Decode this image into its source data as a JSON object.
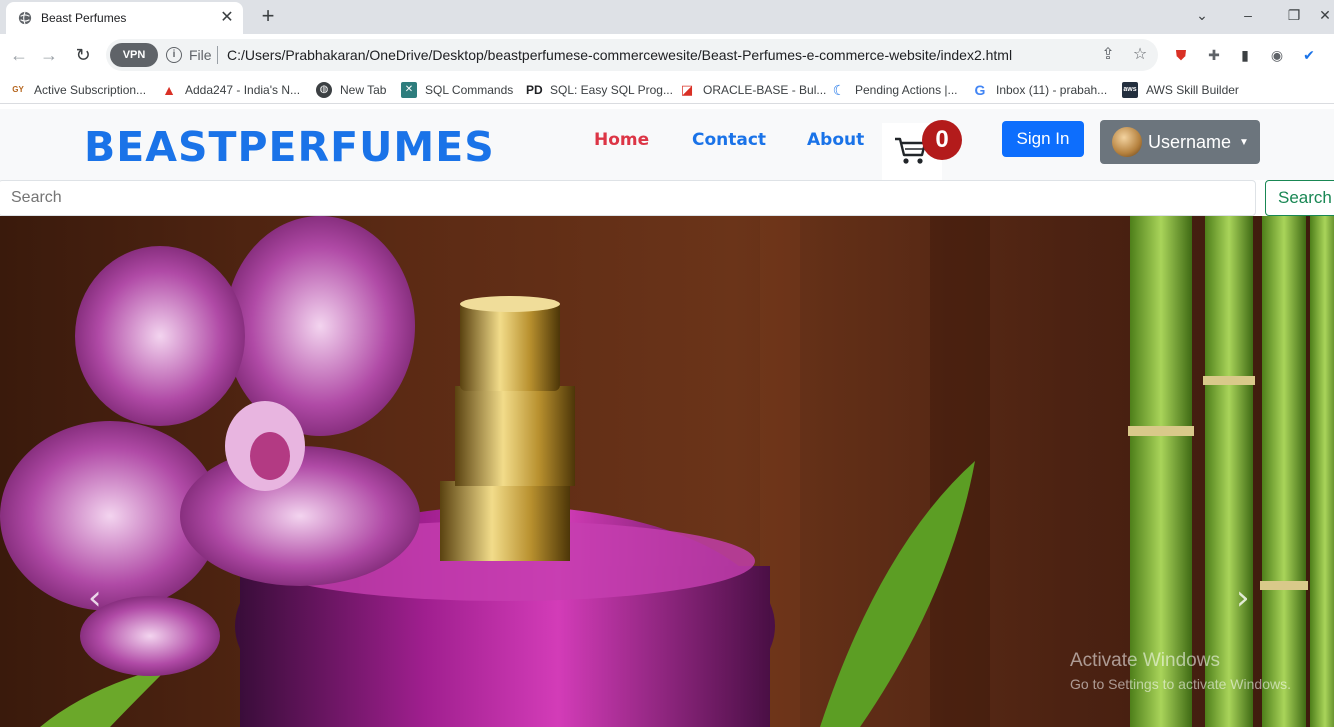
{
  "browser": {
    "tab_title": "Beast Perfumes",
    "tab_close": "✕",
    "new_tab": "+",
    "file_label": "File",
    "url": "C:/Users/Prabhakaran/OneDrive/Desktop/beastperfumese-commercewesite/Beast-Perfumes-e-commerce-website/index2.html",
    "vpn_label": "VPN",
    "bookmarks": [
      {
        "label": "Active Subscription...",
        "icon": "GYTS"
      },
      {
        "label": "Adda247 - India's N...",
        "icon": "A"
      },
      {
        "label": "New Tab",
        "icon": "globe"
      },
      {
        "label": "SQL Commands",
        "icon": "SQL"
      },
      {
        "label": "SQL: Easy SQL Prog...",
        "icon": "PD"
      },
      {
        "label": "ORACLE-BASE - Bul...",
        "icon": "oracle"
      },
      {
        "label": "Pending Actions |...",
        "icon": "K"
      },
      {
        "label": "Inbox (11) - prabah...",
        "icon": "G"
      },
      {
        "label": "AWS Skill Builder",
        "icon": "aws"
      }
    ]
  },
  "site": {
    "brand": "BEASTPERFUMES",
    "nav": {
      "home": "Home",
      "contact": "Contact",
      "about": "About"
    },
    "cart_count": "0",
    "signin": "Sign In",
    "username": "Username",
    "search_placeholder": "Search",
    "search_button": "Search"
  },
  "carousel": {
    "prev": "‹",
    "next": "›"
  },
  "watermark": {
    "title": "Activate Windows",
    "subtitle": "Go to Settings to activate Windows."
  },
  "colors": {
    "brand": "#1a73e8",
    "home_link": "#dc3545",
    "badge": "#b31b1b",
    "signin": "#0d6efd",
    "user_btn": "#6c757d",
    "search_btn": "#198754"
  }
}
